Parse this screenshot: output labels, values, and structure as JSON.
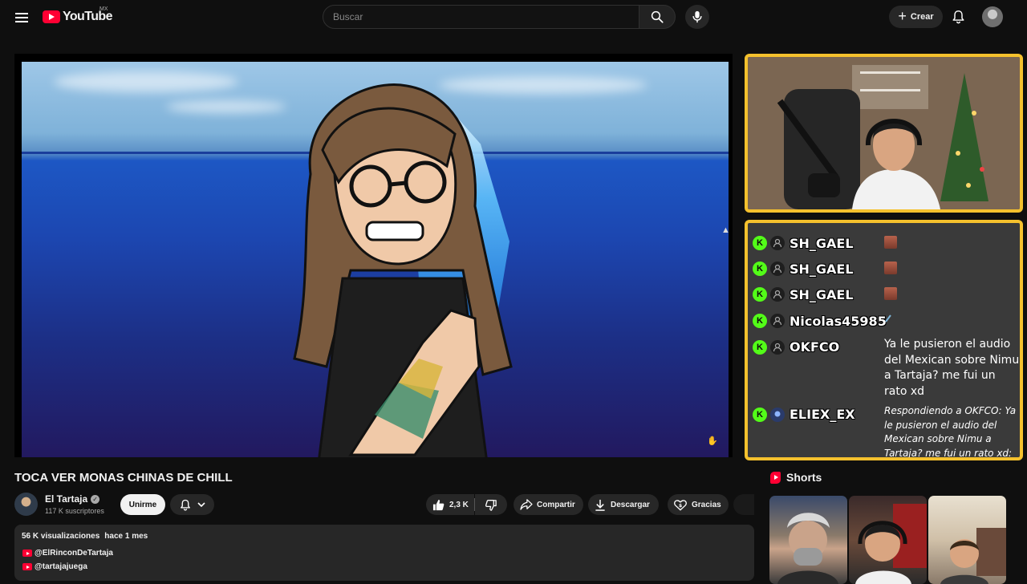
{
  "header": {
    "logo_text": "YouTube",
    "country_code": "MX",
    "search_placeholder": "Buscar",
    "create_label": "Crear"
  },
  "video": {
    "title": "TOCA VER MONAS CHINAS DE CHILL"
  },
  "chat": {
    "messages": [
      {
        "user": "SH_GAEL",
        "text": "",
        "emote": true
      },
      {
        "user": "SH_GAEL",
        "text": "",
        "emote": true
      },
      {
        "user": "SH_GAEL",
        "text": "",
        "emote": true
      },
      {
        "user": "Nicolas45985",
        "text": "",
        "emote": false
      },
      {
        "user": "OKFCO",
        "text": "Ya le pusieron el audio del Mexican sobre Nimu a Tartaja? me fui un rato xd",
        "emote": false
      },
      {
        "user": "ELIEX_EX",
        "text": "Respondiendo a OKFCO: Ya le pusieron el audio del Mexican sobre Nimu a Tartaja? me fui un rato xd: ci",
        "emote": false,
        "reply": true
      }
    ],
    "badge_letter": "K"
  },
  "channel": {
    "name": "El Tartaja",
    "subscribers": "117 K suscriptores",
    "join_label": "Unirme"
  },
  "actions": {
    "likes": "2,3 K",
    "share_label": "Compartir",
    "download_label": "Descargar",
    "thanks_label": "Gracias"
  },
  "description": {
    "views": "56 K visualizaciones",
    "date": "hace 1 mes",
    "links": [
      "@ElRinconDeTartaja",
      "@tartajajuega"
    ]
  },
  "shorts": {
    "heading": "Shorts"
  },
  "colors": {
    "accent": "#ff0033",
    "frame_border": "#f5c12d",
    "kick_green": "#53fc18",
    "background": "#0f0f0f"
  }
}
